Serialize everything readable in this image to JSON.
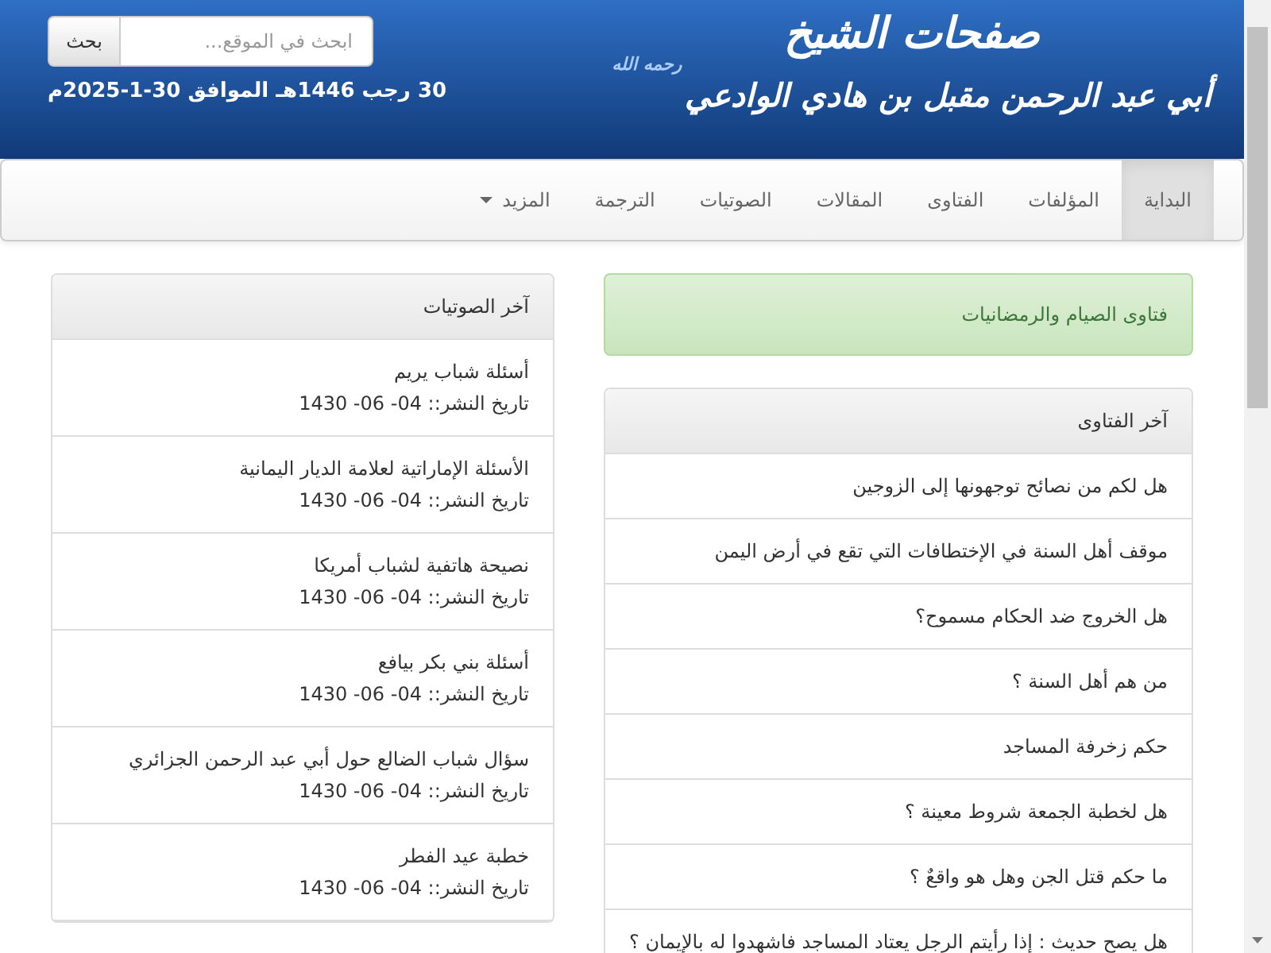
{
  "header": {
    "logo_title": "صفحات الشيخ",
    "logo_name": "أبي عبد الرحمن مقبل بن هادي الوادعي",
    "logo_honorific": "رحمه الله",
    "search": {
      "placeholder": "ابحث في الموقع...",
      "button": "بحث"
    },
    "date": "30 رجب 1446هـ الموافق 30-1-2025م"
  },
  "nav": [
    {
      "label": "البداية",
      "selected": true,
      "dropdown": false
    },
    {
      "label": "المؤلفات",
      "selected": false,
      "dropdown": false
    },
    {
      "label": "الفتاوى",
      "selected": false,
      "dropdown": false
    },
    {
      "label": "المقالات",
      "selected": false,
      "dropdown": false
    },
    {
      "label": "الصوتيات",
      "selected": false,
      "dropdown": false
    },
    {
      "label": "الترجمة",
      "selected": false,
      "dropdown": false
    },
    {
      "label": "المزيد",
      "selected": false,
      "dropdown": true
    }
  ],
  "notice": "فتاوى الصيام والرمضانيات",
  "latest_fatwas": {
    "title": "آخر الفتاوى",
    "items": [
      "هل لكم من نصائح توجهونها إلى الزوجين",
      "موقف أهل السنة في الإختطافات التي تقع في أرض اليمن",
      "هل الخروج ضد الحكام مسموح؟",
      "من هم أهل السنة ؟",
      "حكم زخرفة المساجد",
      "هل لخطبة الجمعة شروط معينة ؟",
      "ما حكم قتل الجن وهل هو واقعٌ ؟",
      "هل يصح حديث : إذا رأيتم الرجل يعتاد المساجد فاشهدوا له بالإيمان ؟"
    ]
  },
  "latest_audio": {
    "title": "آخر الصوتيات",
    "items": [
      {
        "title": "أسئلة شباب يريم",
        "date": "تاريخ النشر:: 04- 06- 1430"
      },
      {
        "title": "الأسئلة الإماراتية لعلامة الديار اليمانية",
        "date": "تاريخ النشر:: 04- 06- 1430"
      },
      {
        "title": "نصيحة هاتفية لشباب أمريكا",
        "date": "تاريخ النشر:: 04- 06- 1430"
      },
      {
        "title": "أسئلة بني بكر بيافع",
        "date": "تاريخ النشر:: 04- 06- 1430"
      },
      {
        "title": "سؤال شباب الضالع حول أبي عبد الرحمن الجزائري",
        "date": "تاريخ النشر:: 04- 06- 1430"
      },
      {
        "title": "خطبة عيد الفطر",
        "date": "تاريخ النشر:: 04- 06- 1430"
      }
    ]
  }
}
